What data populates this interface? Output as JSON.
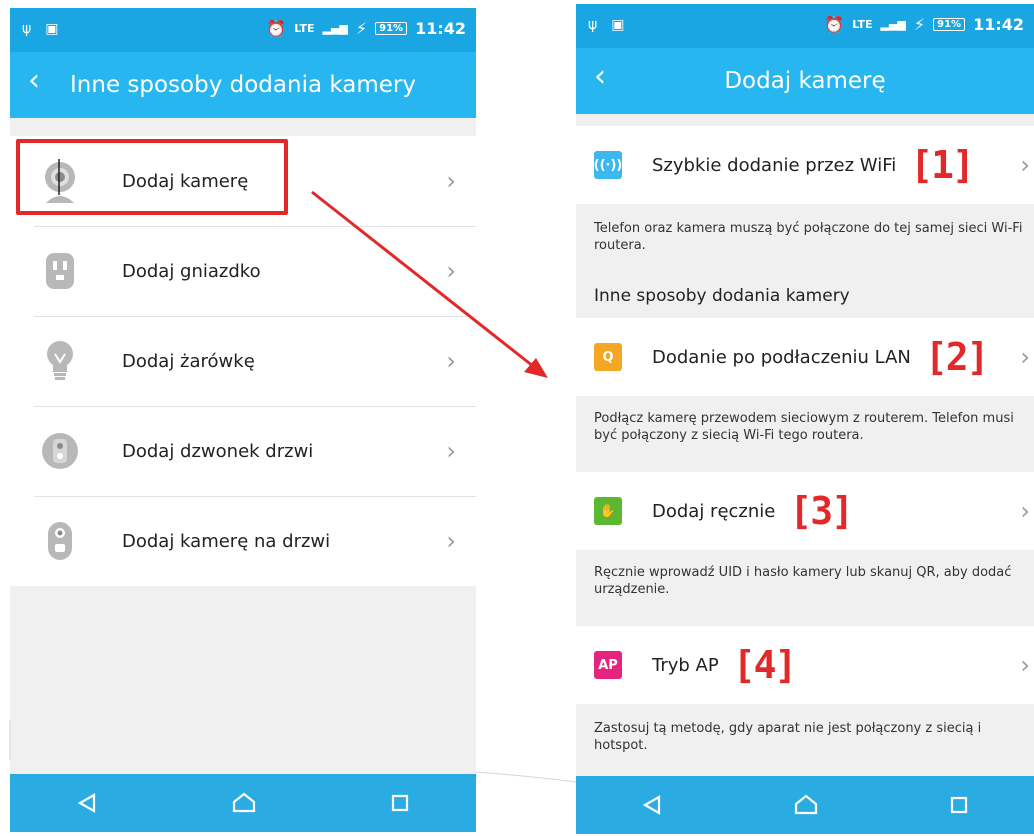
{
  "status_bar": {
    "time": "11:42",
    "battery": "91%",
    "network": "LTE"
  },
  "left_screen": {
    "title": "Inne sposoby dodania kamery",
    "items": [
      {
        "label": "Dodaj kamerę",
        "icon": "camera-icon"
      },
      {
        "label": "Dodaj gniazdko",
        "icon": "plug-icon"
      },
      {
        "label": "Dodaj żarówkę",
        "icon": "bulb-icon"
      },
      {
        "label": "Dodaj dzwonek drzwi",
        "icon": "doorbell-icon"
      },
      {
        "label": "Dodaj kamerę na drzwi",
        "icon": "door-camera-icon"
      }
    ]
  },
  "right_screen": {
    "title": "Dodaj kamerę",
    "options": [
      {
        "label": "Szybkie dodanie przez WiFi",
        "badge": "[1]",
        "tile_text": "((·))",
        "color": "#3cb7f0",
        "description": "Telefon oraz kamera muszą być połączone do tej samej sieci Wi-Fi routera."
      },
      {
        "label": "Dodanie po podłaczeniu LAN",
        "badge": "[2]",
        "tile_text": "Q",
        "color": "#f5a623",
        "description": "Podłącz kamerę przewodem sieciowym z routerem. Telefon musi być połączony z siecią Wi-Fi tego routera."
      },
      {
        "label": "Dodaj ręcznie",
        "badge": "[3]",
        "tile_text": "✋",
        "color": "#5cb82e",
        "description": "Ręcznie wprowadź UID i hasło kamery lub skanuj QR, aby dodać urządzenie."
      },
      {
        "label": "Tryb AP",
        "badge": "[4]",
        "tile_text": "AP",
        "color": "#e5247d",
        "description": "Zastosuj tą metodę, gdy aparat nie jest połączony z siecią i hotspot."
      }
    ],
    "section_header": "Inne sposoby dodania kamery"
  },
  "colors": {
    "status_bar": "#1aa6e3",
    "app_bar": "#27b6ef",
    "highlight": "#e3282a"
  }
}
